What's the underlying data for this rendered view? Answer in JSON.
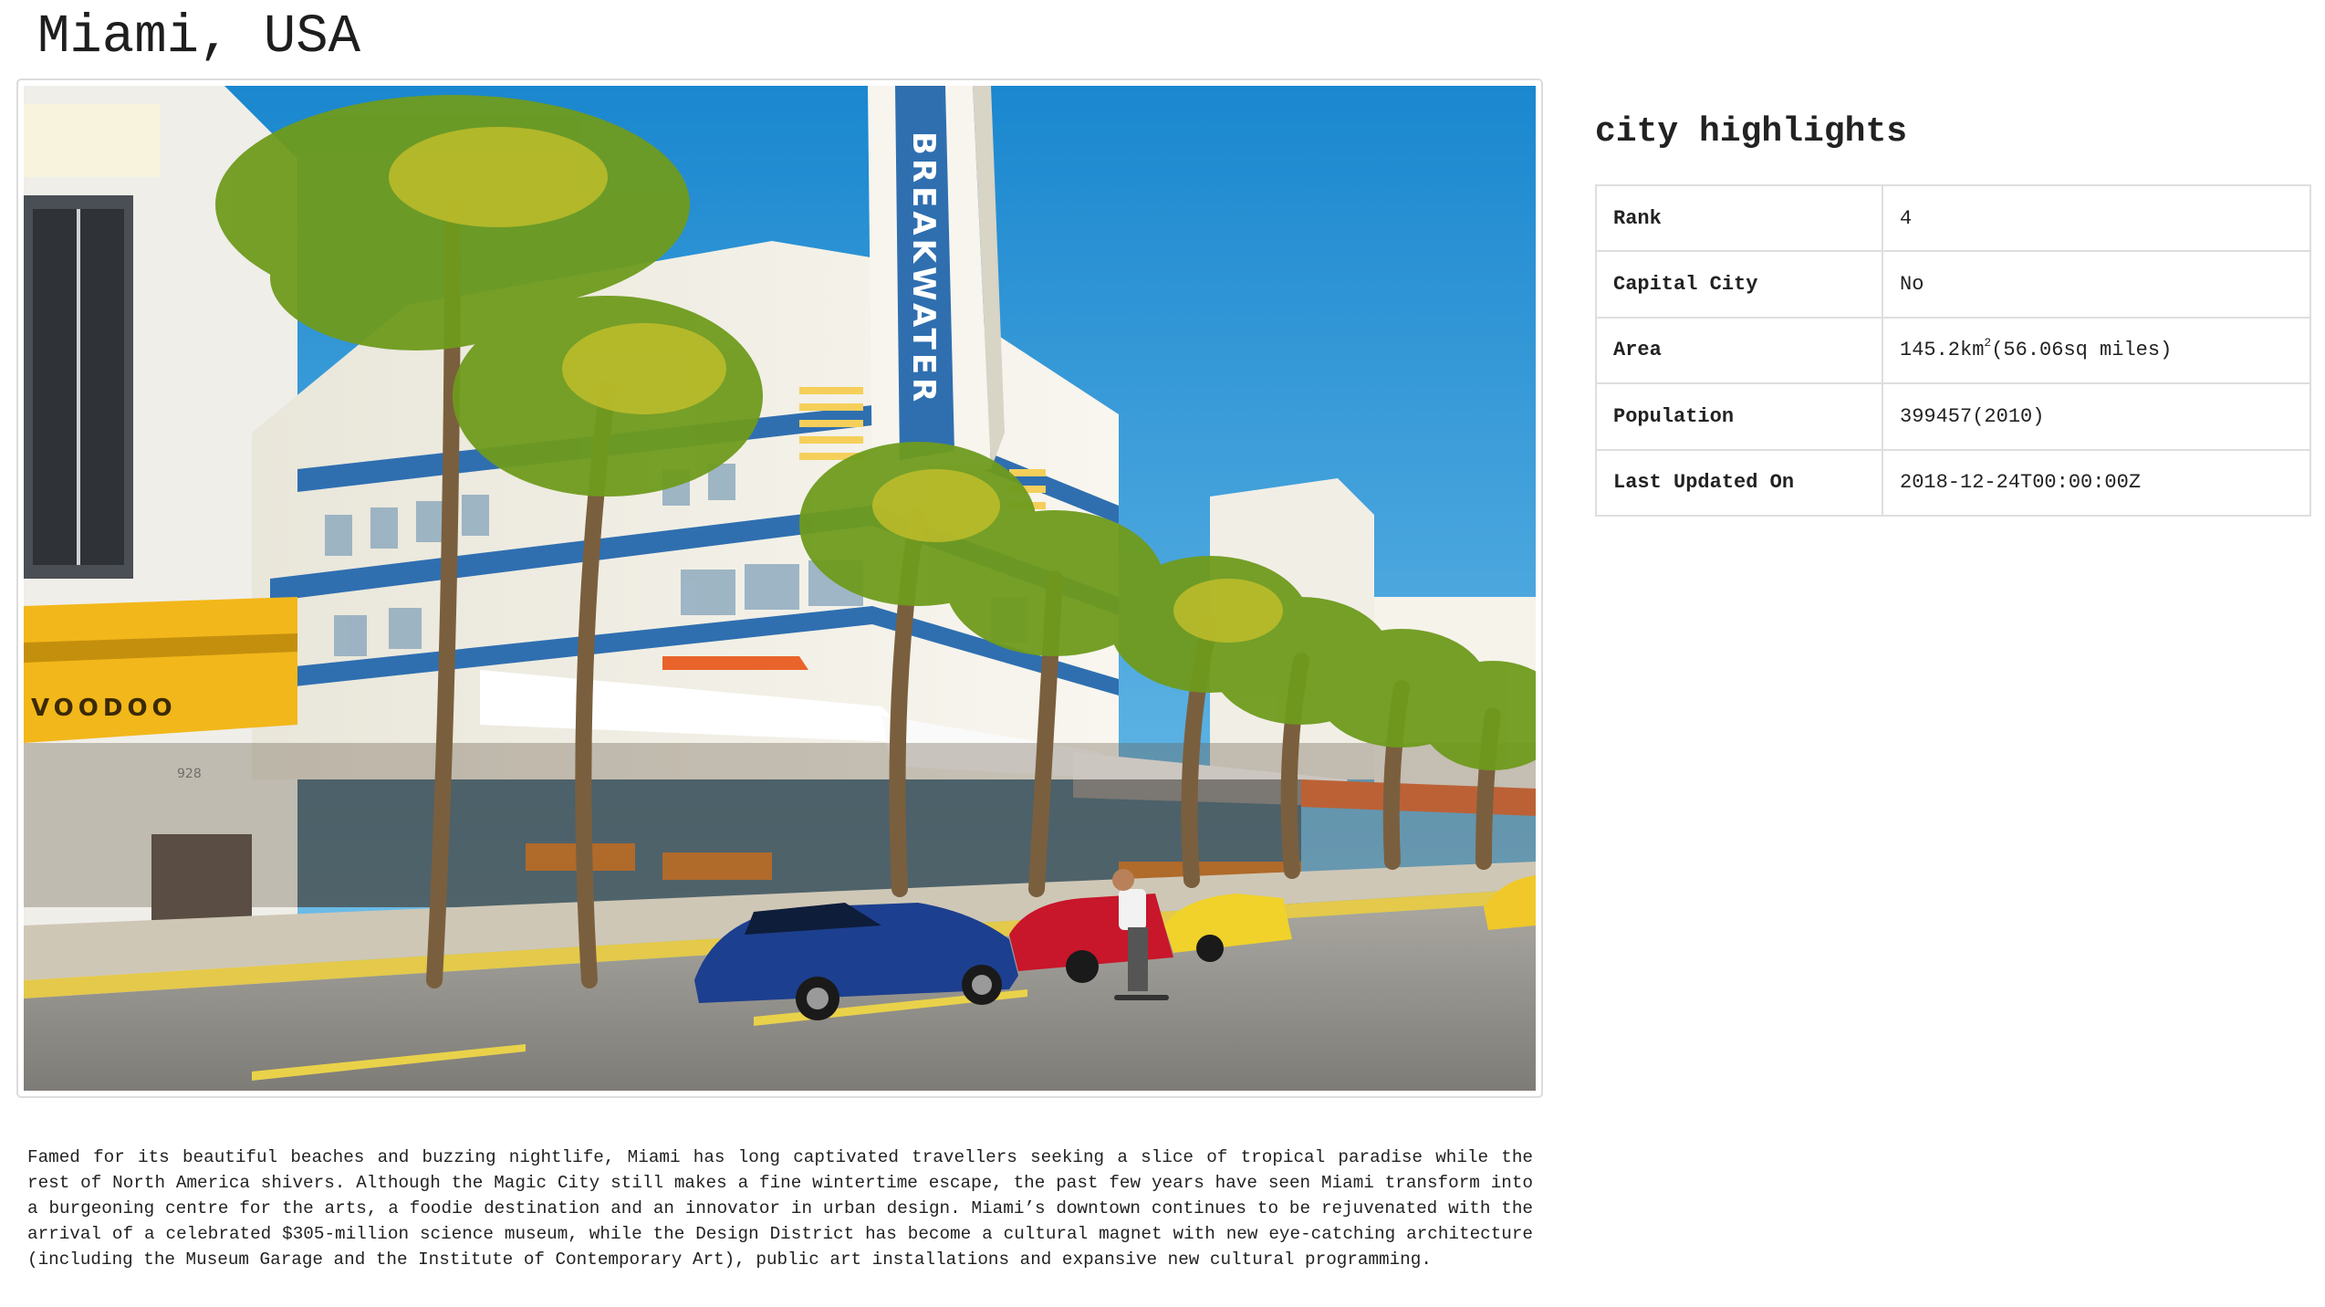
{
  "page": {
    "title": "Miami, USA"
  },
  "photo": {
    "building_sign": "BREAKWATER",
    "cafe_sign": "VOODOO",
    "street_number": "928"
  },
  "description": "Famed for its beautiful beaches and buzzing nightlife, Miami has long captivated travellers seeking a slice of tropical paradise while the rest of North America shivers. Although the Magic City still makes a fine wintertime escape, the past few years have seen Miami transform into a burgeoning centre for the arts, a foodie destination and an innovator in urban design. Miami’s downtown continues to be rejuvenated with the arrival of a celebrated $305-million science museum, while the Design District has become a cultural magnet with new eye-catching architecture (including the Museum Garage and the Institute of Contemporary Art), public art installations and expansive new cultural programming.",
  "highlights": {
    "title": "city highlights",
    "rank_label": "Rank",
    "rank_value": "4",
    "capital_label": "Capital City",
    "capital_value": "No",
    "area_label": "Area",
    "area_km": "145.2km",
    "area_sup": "2",
    "area_miles": "(56.06sq miles)",
    "population_label": "Population",
    "population_value": "399457(2010)",
    "updated_label": "Last Updated On",
    "updated_value": "2018-12-24T00:00:00Z"
  },
  "colors": {
    "sky_top": "#1a87cf",
    "sky_bottom": "#6fbfe9",
    "building": "#f3f1e8",
    "accent_blue": "#2f6fb0",
    "awning_yellow": "#f2b71a",
    "road": "#8e8c86",
    "palm_green": "#6d9a1c",
    "table_border": "#dedede"
  }
}
